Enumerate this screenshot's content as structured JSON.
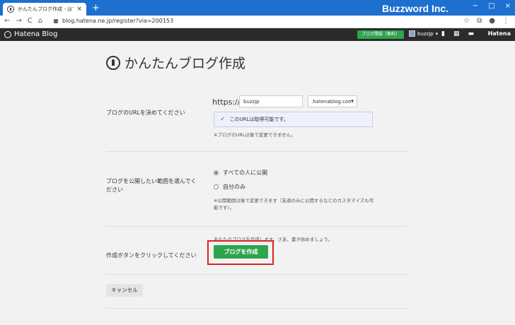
{
  "browser": {
    "tab_title": "かんたんブログ作成 - はてなブログ",
    "tab_close": "×",
    "new_tab": "+",
    "brand": "Buzzword Inc.",
    "window_controls": [
      "−",
      "□",
      "×"
    ],
    "nav_icons": [
      "←",
      "→",
      "C",
      "⌂"
    ],
    "url": "blog.hatena.ne.jp/register?via=200153",
    "right_icons": [
      "☆",
      "⧉",
      "●",
      "⋮"
    ]
  },
  "header": {
    "logo": "Hatena Blog",
    "open_blog": "ブログ開設（無料）",
    "user": "buzzjp",
    "icons": [
      "▮",
      "▦",
      "▬"
    ],
    "hatena": "Hatena"
  },
  "page": {
    "title": "かんたんブログ作成",
    "url_section": {
      "label": "ブログのURLを決めてください",
      "scheme": "https://",
      "subdomain_value": "buzzjp",
      "domain_selected": ".hatenablog.com",
      "notice": "このURLは取得可能です。",
      "note": "※ブログのURLは後で変更できません。"
    },
    "visibility_section": {
      "label": "ブログを公開したい範囲を選んでください",
      "options": [
        "すべての人に公開",
        "自分のみ"
      ],
      "selected": "すべての人に公開",
      "note": "※公開範囲は後で変更できます（友達のみに公開するなどのカスタマイズも可能です）。"
    },
    "create_section": {
      "label": "作成ボタンをクリックしてください",
      "hint": "あなたのブログを作成します。さあ、書き始めましょう。",
      "button": "ブログを作成"
    },
    "cancel_button": "キャンセル"
  },
  "colors": {
    "chrome_blue": "#1d6fd0",
    "header_dark": "#2b2b2b",
    "green_button": "#2ea44f",
    "highlight_red": "#e0201f"
  }
}
